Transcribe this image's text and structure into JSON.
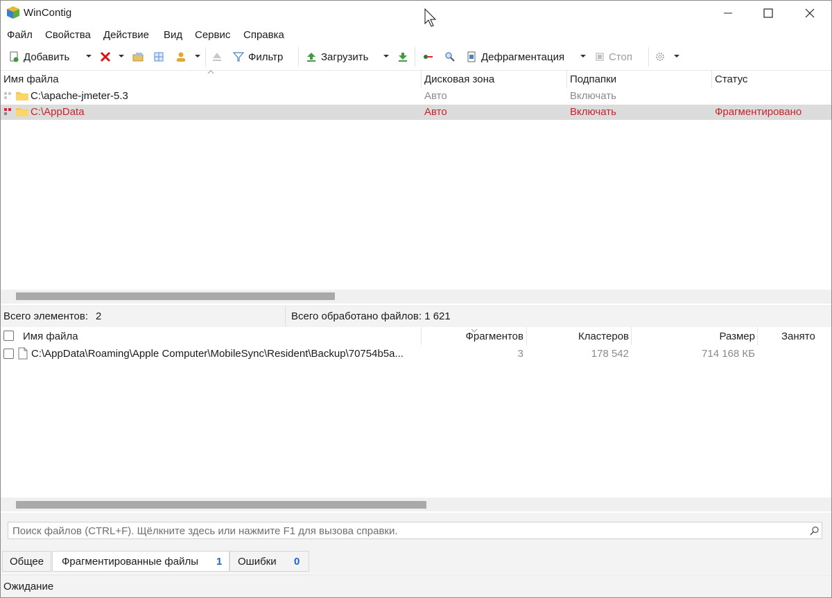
{
  "window": {
    "title": "WinContig"
  },
  "menu": [
    {
      "label": "Файл"
    },
    {
      "label": "Свойства"
    },
    {
      "label": "Действие"
    },
    {
      "label": "Вид"
    },
    {
      "label": "Сервис"
    },
    {
      "label": "Справка"
    }
  ],
  "toolbar": {
    "add_label": "Добавить",
    "filter_label": "Фильтр",
    "load_label": "Загрузить",
    "defrag_label": "Дефрагментация",
    "stop_label": "Стоп"
  },
  "folders": {
    "columns": [
      "Имя файла",
      "Дисковая зона",
      "Подпапки",
      "Статус"
    ],
    "rows": [
      {
        "name": "C:\\apache-jmeter-5.3",
        "zone": "Авто",
        "subfolders": "Включать",
        "status": ""
      },
      {
        "name": "C:\\AppData",
        "zone": "Авто",
        "subfolders": "Включать",
        "status": "Фрагментировано"
      }
    ],
    "selected_row_color": "#d9d9d9",
    "fragmented_color": "#c0262d",
    "scroll_fraction": 0.39
  },
  "summary": {
    "total_items_label": "Всего элементов:",
    "total_items_value": "2",
    "processed_text": "Всего обработано файлов: 1 621"
  },
  "files": {
    "columns": [
      "Имя файла",
      "Фрагментов",
      "Кластеров",
      "Размер",
      "Занято"
    ],
    "rows": [
      {
        "name": "C:\\AppData\\Roaming\\Apple Computer\\MobileSync\\Resident\\Backup\\70754b5a...",
        "fragments": "3",
        "clusters": "178 542",
        "size": "714 168 КБ"
      }
    ],
    "scroll_fraction": 0.49
  },
  "search": {
    "placeholder": "Поиск файлов (CTRL+F). Щёлкните здесь или нажмите F1 для вызова справки."
  },
  "tabs": [
    {
      "label": "Общее",
      "count": ""
    },
    {
      "label": "Фрагментированные файлы",
      "count": "1"
    },
    {
      "label": "Ошибки",
      "count": "0"
    }
  ],
  "status_bar": {
    "text": "Ожидание"
  }
}
